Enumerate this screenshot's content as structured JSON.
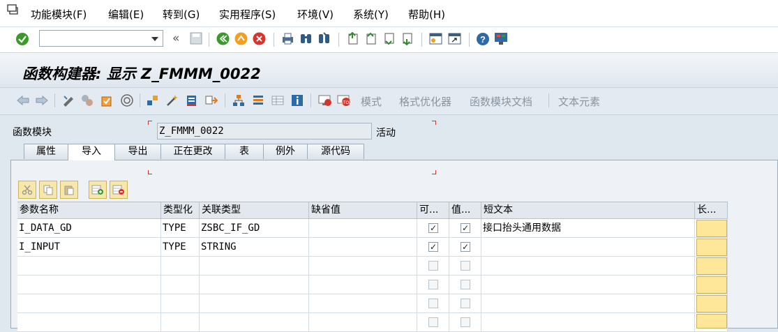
{
  "menu": [
    "功能模块(F)",
    "编辑(E)",
    "转到(G)",
    "实用程序(S)",
    "环境(V)",
    "系统(Y)",
    "帮助(H)"
  ],
  "command_field": {
    "value": ""
  },
  "title": "函数构建器: 显示 Z_FMMM_0022",
  "app_toolbar": {
    "mode": "模式",
    "pretty_printer": "格式优化器",
    "fm_docs": "函数模块文档",
    "text_elements": "文本元素"
  },
  "fields": {
    "fm_label": "函数模块",
    "fm_value": "Z_FMMM_0022",
    "status": "活动"
  },
  "tabs": [
    "属性",
    "导入",
    "导出",
    "正在更改",
    "表",
    "例外",
    "源代码"
  ],
  "active_tab": "导入",
  "table": {
    "headers": [
      "参数名称",
      "类型化",
      "关联类型",
      "缺省值",
      "可...",
      "值...",
      "短文本",
      "长..."
    ],
    "rows": [
      {
        "name": "I_DATA_GD",
        "typing": "TYPE",
        "ref_type": "ZSBC_IF_GD",
        "default": "",
        "optional": true,
        "pass_value": true,
        "short_text": "接口抬头通用数据"
      },
      {
        "name": "I_INPUT",
        "typing": "TYPE",
        "ref_type": "STRING",
        "default": "",
        "optional": true,
        "pass_value": true,
        "short_text": ""
      }
    ],
    "empty_rows": 4
  },
  "colors": {
    "accent_yellow": "#ffe79a",
    "panel": "#eef2f6",
    "header": "#e2e8ee",
    "green_ok": "#3a9a2a",
    "cancel_red": "#d9342b"
  }
}
